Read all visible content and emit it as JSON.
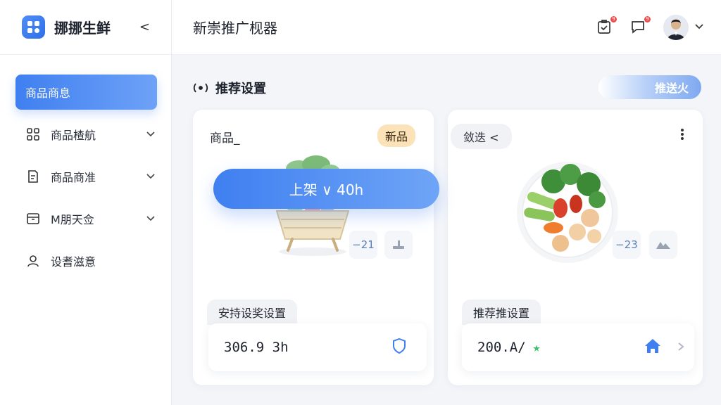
{
  "brand": {
    "name": "挪挪生鲜",
    "collapse_glyph": "<"
  },
  "header": {
    "title": "新崇推广枧器",
    "notif_count_a": "9",
    "notif_count_b": "9"
  },
  "sidebar": {
    "items": [
      {
        "label": "商品商息",
        "icon": "none",
        "active": true
      },
      {
        "label": "商品楂航",
        "icon": "grid-icon",
        "expandable": true
      },
      {
        "label": "商品商准",
        "icon": "document-icon",
        "expandable": true
      },
      {
        "label": "M朋天佥",
        "icon": "card-icon",
        "expandable": true
      },
      {
        "label": "设耆滋意",
        "icon": "user-icon",
        "expandable": false
      }
    ]
  },
  "main": {
    "section_title": "推荐设置",
    "push_button": "推送火",
    "card_a": {
      "label": "商品_",
      "badge": "新品",
      "floating_button": "上架 ∨ 40h",
      "mini_stat": "−21",
      "sub_label": "安持设奖设置",
      "value": "306.9 3h"
    },
    "card_b": {
      "pill": "敛迭 <",
      "mini_stat": "−23",
      "sub_label": "推荐推设置",
      "value": "200.A/"
    }
  },
  "colors": {
    "accent": "#3f7ff0",
    "badge_bg": "#fbe2b8",
    "star": "#3cc26a"
  }
}
